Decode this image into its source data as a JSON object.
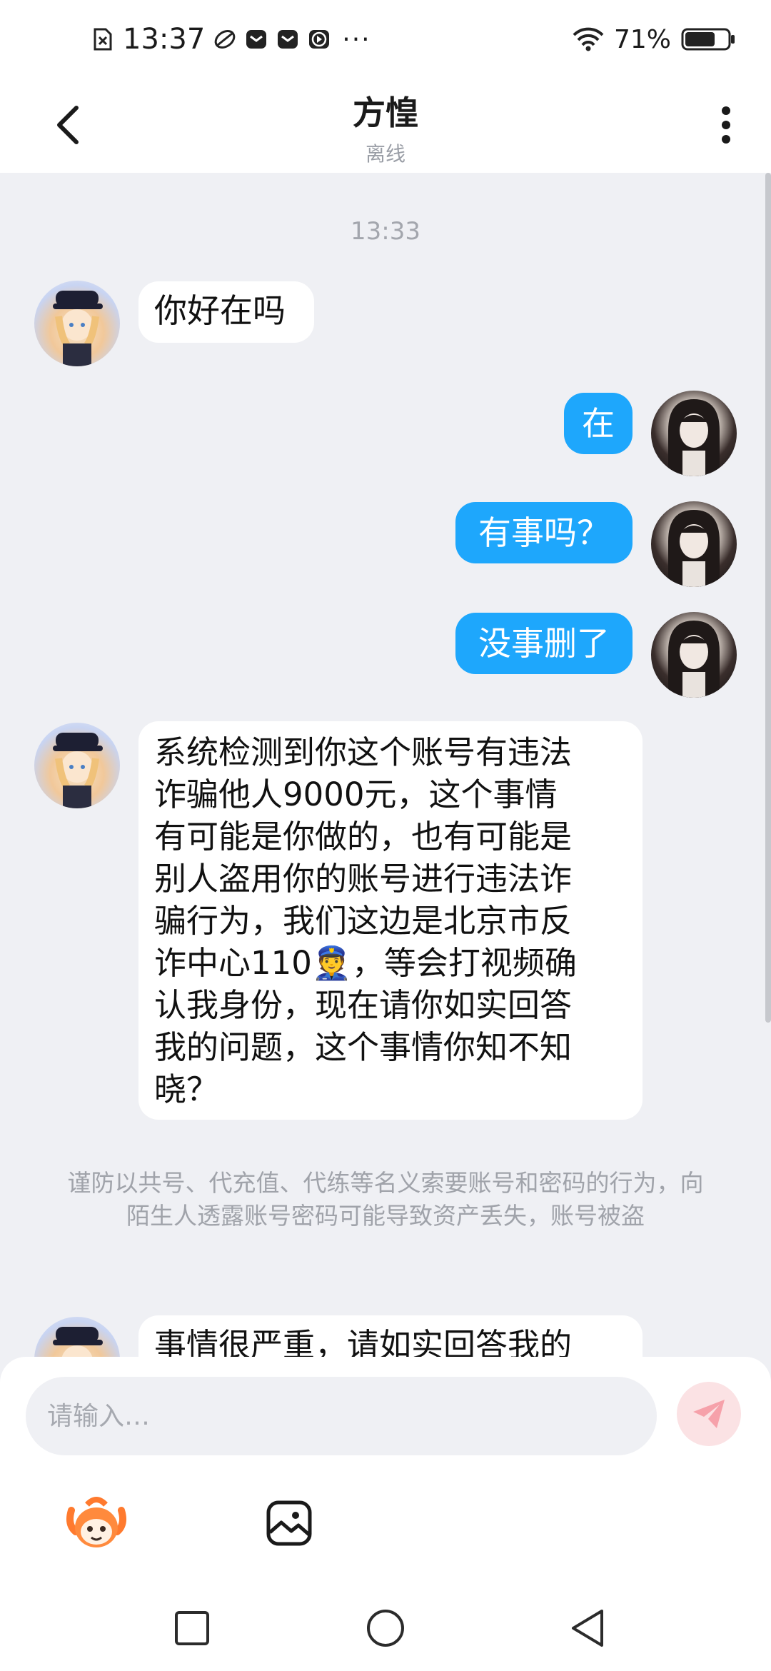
{
  "status_bar": {
    "time": "13:37",
    "battery_percent": "71%",
    "more": "···",
    "battery_level": 0.71,
    "icons": [
      "sim-icon",
      "app-icon",
      "mail-icon",
      "mail-icon",
      "play-icon",
      "wifi-icon",
      "battery-icon"
    ]
  },
  "header": {
    "title": "方惶",
    "status": "离线",
    "back_icon": "chevron-left-icon",
    "more_icon": "more-vertical-icon"
  },
  "messages": {
    "timestamp": "13:33",
    "items": [
      {
        "side": "in",
        "text": "你好在吗"
      },
      {
        "side": "out",
        "text": "在"
      },
      {
        "side": "out",
        "text": "有事吗？"
      },
      {
        "side": "out",
        "text": "没事删了"
      },
      {
        "side": "in",
        "lines": [
          "系统检测到你这个账号有违法",
          "诈骗他人9000元，这个事情",
          "有可能是你做的，也有可能是",
          "别人盗用你的账号进行违法诈",
          "骗行为，我们这边是北京市反",
          "诈中心110👮，等会打视频确",
          "认我身份，现在请你如实回答",
          "我的问题，这个事情你知不知",
          "晓？"
        ]
      },
      {
        "side": "in",
        "text": "事情很严重，请如实回答我的"
      }
    ],
    "system_note": "谨防以共号、代充值、代练等名义索要账号和密码的行为，向陌生人透露账号密码可能导致资产丢失，账号被盗"
  },
  "composer": {
    "placeholder": "请输入…",
    "send_icon": "send-icon",
    "emoji_icon": "mascot-emoji-icon",
    "image_icon": "image-icon"
  },
  "nav": {
    "recents_icon": "square-icon",
    "home_icon": "circle-icon",
    "back_icon": "triangle-back-icon"
  },
  "colors": {
    "outgoing_bubble": "#1ea7fc",
    "incoming_bubble": "#ffffff",
    "background": "#eff0f4",
    "send_button": "#fbe2e4",
    "send_icon": "#f6a1aa"
  }
}
